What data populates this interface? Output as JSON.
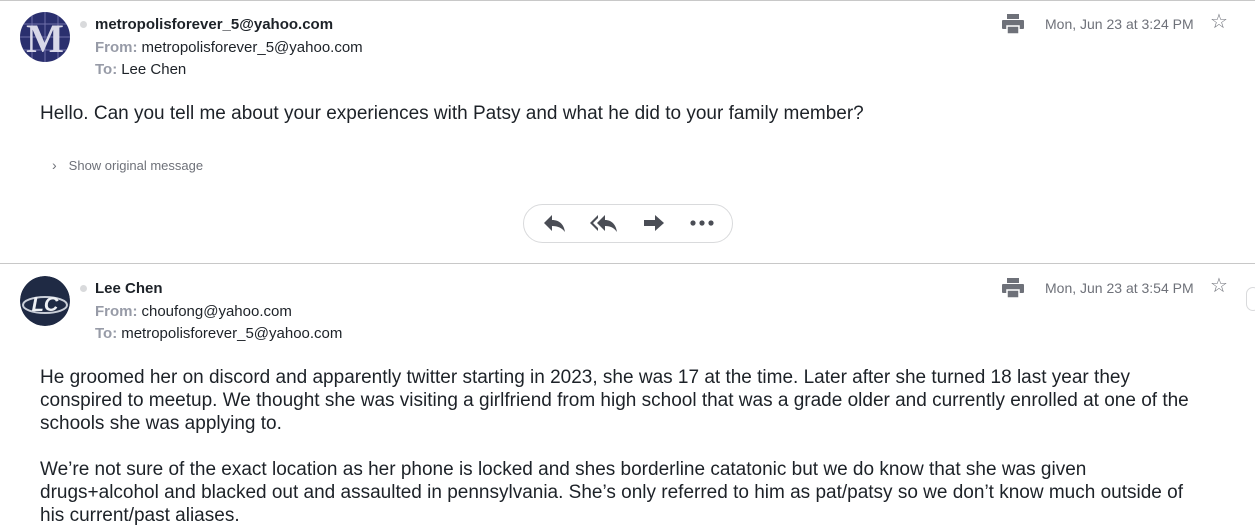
{
  "messages": [
    {
      "sender": "metropolisforever_5@yahoo.com",
      "from_label": "From:",
      "from": "metropolisforever_5@yahoo.com",
      "to_label": "To:",
      "to": "Lee Chen",
      "date": "Mon, Jun 23 at 3:24 PM",
      "avatar_text": "M",
      "body": [
        "Hello.  Can you tell me about your experiences with Patsy and what he did to your family member?"
      ],
      "show_original": "Show original message"
    },
    {
      "sender": "Lee Chen",
      "from_label": "From:",
      "from": "choufong@yahoo.com",
      "to_label": "To:",
      "to": "metropolisforever_5@yahoo.com",
      "date": "Mon, Jun 23 at 3:54 PM",
      "avatar_text": "LC",
      "body": [
        "He groomed her on discord and apparently twitter starting in 2023, she was 17 at the time. Later after she turned 18 last year they conspired to meetup. We thought she was visiting a girlfriend from high school that was a grade older and currently enrolled at one of the schools she was applying to.",
        "We’re not sure of the exact location as her phone is locked and shes borderline catatonic but we do know that she was given drugs+alcohol and blacked out and assaulted in pennsylvania. She’s only referred to him as pat/patsy so we don’t know much outside of his current/past aliases."
      ]
    }
  ],
  "actions": [
    {
      "icon": "reply-icon"
    },
    {
      "icon": "reply-all-icon"
    },
    {
      "icon": "forward-icon"
    },
    {
      "icon": "more-icon"
    }
  ],
  "colors": {
    "accent": "#1d2228",
    "muted": "#6e7179",
    "label": "#979ba7",
    "divider": "#c8c8c8"
  }
}
